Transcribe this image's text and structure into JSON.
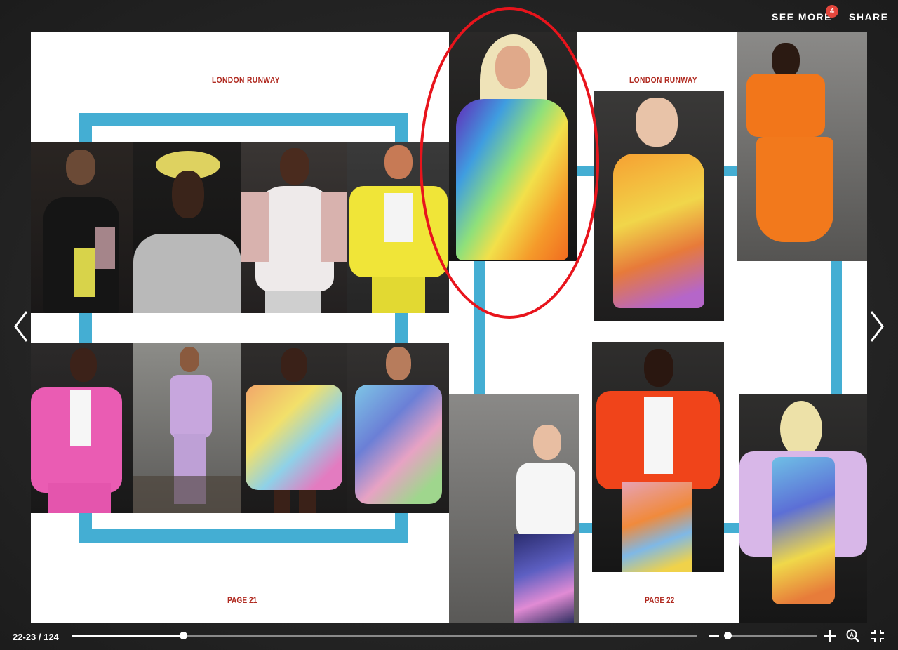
{
  "header": {
    "see_more_label": "SEE MORE",
    "see_more_badge": "4",
    "share_label": "SHARE"
  },
  "pages": {
    "left": {
      "heading": "LONDON RUNWAY",
      "page_label": "PAGE 21"
    },
    "right": {
      "heading": "LONDON RUNWAY",
      "page_label": "PAGE 22"
    }
  },
  "footer": {
    "page_counter": "22-23 / 124",
    "progress": 0.178,
    "zoom": 0.0
  },
  "icons": {
    "prev": "chevron-left-icon",
    "next": "chevron-right-icon",
    "zoom_out": "minus-icon",
    "zoom_in": "plus-icon",
    "auto_zoom": "magnifier-a-icon",
    "fullscreen_exit": "collapse-icon"
  },
  "colors": {
    "accent_blue": "#44aed3",
    "heading_red": "#b02a20",
    "highlight_red": "#e8141c",
    "badge": "#e3463c"
  }
}
